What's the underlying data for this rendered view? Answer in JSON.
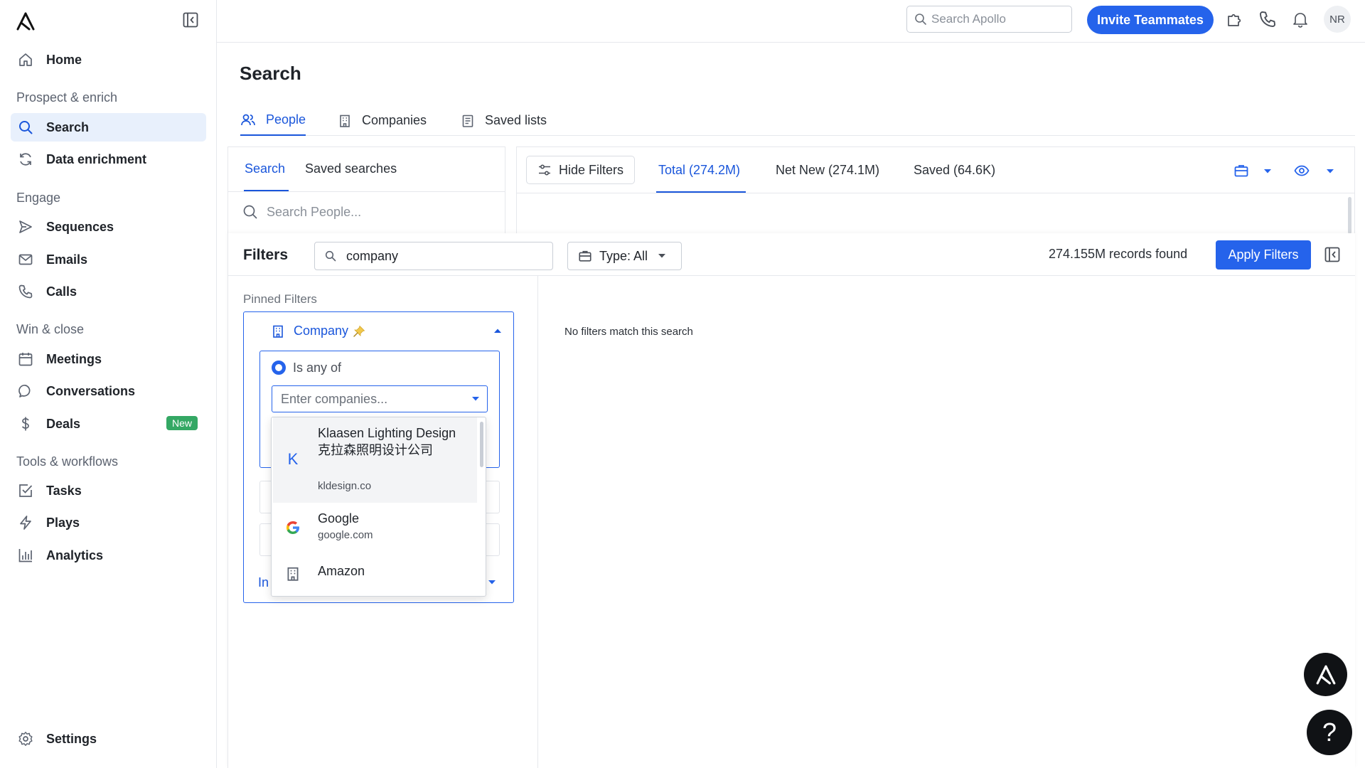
{
  "sidebar": {
    "home": "Home",
    "sections": [
      "Prospect & enrich",
      "Engage",
      "Win & close",
      "Tools & workflows"
    ],
    "items": {
      "search": "Search",
      "data_enrichment": "Data enrichment",
      "sequences": "Sequences",
      "emails": "Emails",
      "calls": "Calls",
      "meetings": "Meetings",
      "conversations": "Conversations",
      "deals": "Deals",
      "deals_badge": "New",
      "tasks": "Tasks",
      "plays": "Plays",
      "analytics": "Analytics",
      "settings": "Settings"
    }
  },
  "topbar": {
    "search_placeholder": "Search Apollo",
    "invite_label": "Invite Teammates",
    "avatar_initials": "NR"
  },
  "page": {
    "title": "Search",
    "tabs": [
      "People",
      "Companies",
      "Saved lists"
    ],
    "active_tab": "People"
  },
  "left_card": {
    "tabs": [
      "Search",
      "Saved searches"
    ],
    "search_placeholder": "Search People..."
  },
  "results": {
    "hide_filters": "Hide Filters",
    "tabs": [
      "Total (274.2M)",
      "Net New (274.1M)",
      "Saved (64.6K)"
    ]
  },
  "filters": {
    "title": "Filters",
    "search_value": "company",
    "type_label": "Type: All",
    "records_found": "274.155M records found",
    "apply_label": "Apply Filters",
    "pinned_label": "Pinned Filters",
    "no_match": "No filters match this search",
    "company": {
      "label": "Company",
      "mode_label": "Is any of",
      "input_placeholder": "Enter companies...",
      "include_label": "In"
    }
  },
  "dropdown": {
    "items": [
      {
        "name": "Klaasen Lighting Design 克拉森照明设计公司",
        "domain": "kldesign.co",
        "icon": "letter-k-icon",
        "letter": "K"
      },
      {
        "name": "Google",
        "domain": "google.com",
        "icon": "google-logo-icon"
      },
      {
        "name": "Amazon",
        "domain": "",
        "icon": "building-icon"
      }
    ]
  },
  "colors": {
    "accent": "#2563eb",
    "active_bg": "#e8f0fc",
    "badge_green": "#34a864"
  }
}
